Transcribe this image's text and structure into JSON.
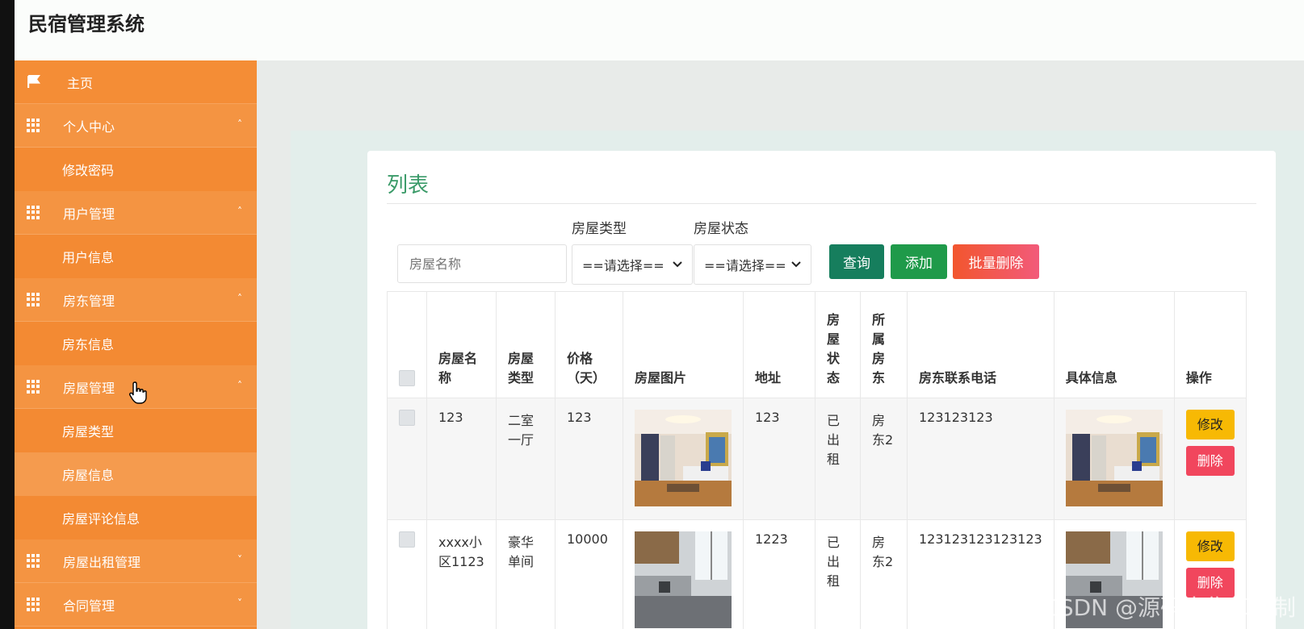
{
  "app": {
    "title": "民宿管理系统"
  },
  "sidebar": {
    "items": [
      {
        "label": "主页",
        "icon": "flag-icon",
        "kind": "top"
      },
      {
        "label": "个人中心",
        "icon": "grid-icon",
        "kind": "group",
        "arrow": "˄"
      },
      {
        "label": "修改密码",
        "kind": "sub"
      },
      {
        "label": "用户管理",
        "icon": "grid-icon",
        "kind": "group",
        "arrow": "˄"
      },
      {
        "label": "用户信息",
        "kind": "sub"
      },
      {
        "label": "房东管理",
        "icon": "grid-icon",
        "kind": "group",
        "arrow": "˄"
      },
      {
        "label": "房东信息",
        "kind": "sub"
      },
      {
        "label": "房屋管理",
        "icon": "grid-icon",
        "kind": "group",
        "arrow": "˄"
      },
      {
        "label": "房屋类型",
        "kind": "sub"
      },
      {
        "label": "房屋信息",
        "kind": "sub",
        "active": true
      },
      {
        "label": "房屋评论信息",
        "kind": "sub"
      },
      {
        "label": "房屋出租管理",
        "icon": "grid-icon",
        "kind": "group",
        "arrow": "˅"
      },
      {
        "label": "合同管理",
        "icon": "grid-icon",
        "kind": "group",
        "arrow": "˅"
      }
    ]
  },
  "main": {
    "card_title": "列表",
    "filters": {
      "name_placeholder": "房屋名称",
      "type_label": "房屋类型",
      "type_value": "==请选择==",
      "status_label": "房屋状态",
      "status_value": "==请选择=="
    },
    "buttons": {
      "query": "查询",
      "add": "添加",
      "batch_delete": "批量删除"
    },
    "table": {
      "headers": [
        "房屋名称",
        "房屋类型",
        "价格（天）",
        "房屋图片",
        "地址",
        "房屋状态",
        "所属房东",
        "房东联系电话",
        "具体信息",
        "操作"
      ],
      "rows": [
        {
          "name": "123",
          "type": "二室一厅",
          "price": "123",
          "address": "123",
          "status": "已出租",
          "owner": "房东2",
          "phone": "123123123"
        },
        {
          "name": "xxxx小区1123",
          "type": "豪华单间",
          "price": "10000",
          "address": "1223",
          "status": "已出租",
          "owner": "房东2",
          "phone": "123123123123123"
        }
      ],
      "edit_label": "修改",
      "delete_label": "删除"
    }
  },
  "watermark": "CSDN @源码出售和定制",
  "colors": {
    "sidebar": "#f38a33",
    "accent_green": "#3a9a68",
    "query": "#167e5d",
    "add": "#1f9a4a",
    "delete": "#f1465d",
    "edit": "#f7b904"
  }
}
